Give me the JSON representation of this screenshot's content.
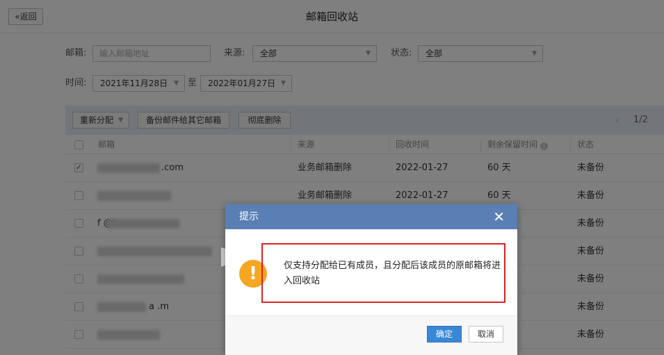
{
  "header": {
    "back_label": "«返回",
    "title": "邮箱回收站"
  },
  "filters": {
    "email_label": "邮箱:",
    "email_placeholder": "输入邮箱地址",
    "source_label": "来源:",
    "source_value": "全部",
    "status_label": "状态:",
    "status_value": "全部",
    "time_label": "时间:",
    "date_from": "2021年11月28日",
    "date_sep": "至",
    "date_to": "2022年01月27日"
  },
  "toolbar": {
    "reassign_label": "重新分配",
    "backup_label": "备份邮件给其它邮箱",
    "delete_label": "彻底删除",
    "page_indicator": "1/2"
  },
  "table": {
    "columns": [
      "邮箱",
      "来源",
      "回收时间",
      "剩余保留时间",
      "状态"
    ],
    "rows": [
      {
        "email": ".com",
        "source": "业务邮箱删除",
        "time": "2022-01-27",
        "remain": "60 天",
        "status": "未备份",
        "checked": true
      },
      {
        "email": "",
        "source": "业务邮箱删除",
        "time": "2022-01-27",
        "remain": "60 天",
        "status": "未备份",
        "checked": false
      },
      {
        "email": "f @h",
        "source": "",
        "time": "",
        "remain": "",
        "status": "未备份",
        "checked": false
      },
      {
        "email": "",
        "source": "",
        "time": "",
        "remain": "",
        "status": "未备份",
        "checked": false
      },
      {
        "email": "",
        "source": "",
        "time": "",
        "remain": "",
        "status": "未备份",
        "checked": false
      },
      {
        "email": "a .m",
        "source": "",
        "time": "",
        "remain": "",
        "status": "未备份",
        "checked": false
      },
      {
        "email": "",
        "source": "",
        "time": "",
        "remain": "",
        "status": "未备份",
        "checked": false
      }
    ]
  },
  "dialog": {
    "title": "提示",
    "icon": "exclamation",
    "message": "仅支持分配给已有成员，且分配后该成员的原邮箱将进入回收站",
    "ok_label": "确定",
    "cancel_label": "取消"
  },
  "colors": {
    "dialog_header": "#5a7fb5",
    "primary_button": "#3a87d6",
    "warning": "#f5a623",
    "highlight": "#e02020"
  }
}
